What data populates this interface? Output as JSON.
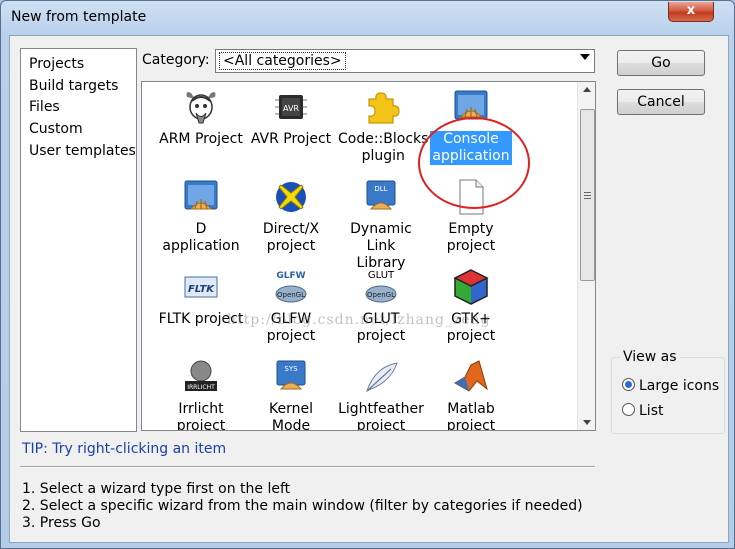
{
  "window": {
    "title": "New from template",
    "close_glyph": "x"
  },
  "left_list": {
    "items": [
      "Projects",
      "Build targets",
      "Files",
      "Custom",
      "User templates"
    ]
  },
  "category": {
    "label": "Category:",
    "value": "<All categories>"
  },
  "templates": [
    {
      "label": "ARM Project",
      "icon": "gnu-icon"
    },
    {
      "label": "AVR Project",
      "icon": "avr-chip-icon"
    },
    {
      "label": "Code::Blocks\nplugin",
      "icon": "puzzle-piece-icon"
    },
    {
      "label": "Console\napplication",
      "icon": "console-app-icon",
      "selected": true
    },
    {
      "label": "D application",
      "icon": "d-app-icon"
    },
    {
      "label": "Direct/X\nproject",
      "icon": "directx-icon"
    },
    {
      "label": "Dynamic Link\nLibrary",
      "icon": "dll-icon"
    },
    {
      "label": "Empty\nproject",
      "icon": "blank-document-icon"
    },
    {
      "label": "FLTK project",
      "icon": "fltk-icon"
    },
    {
      "label": "GLFW\nproject",
      "icon": "glfw-icon"
    },
    {
      "label": "GLUT\nproject",
      "icon": "glut-icon"
    },
    {
      "label": "GTK+\nproject",
      "icon": "gtk-icon"
    },
    {
      "label": "Irrlicht\nproject",
      "icon": "irrlicht-icon"
    },
    {
      "label": "Kernel Mode\nDriver",
      "icon": "sys-driver-icon"
    },
    {
      "label": "Lightfeather\nproject",
      "icon": "feather-icon"
    },
    {
      "label": "Matlab\nproject",
      "icon": "matlab-icon"
    }
  ],
  "icon_text": {
    "avr": "AVR",
    "dll": "DLL",
    "fltk": "FLTK",
    "glfw": "GLFW",
    "glut": "GLUT",
    "sys": "SYS",
    "irrlicht": "IRRLICHT",
    "opengl": "OpenGL"
  },
  "watermark": "http://blog.csdn.net/lzhang_zeng",
  "buttons": {
    "go": "Go",
    "cancel": "Cancel"
  },
  "view_as": {
    "title": "View as",
    "large_icons": "Large icons",
    "list": "List",
    "selected": "Large icons"
  },
  "tip": "TIP: Try right-clicking an item",
  "instructions": [
    "1. Select a wizard type first on the left",
    "2. Select a specific wizard from the main window (filter by categories if needed)",
    "3. Press Go"
  ],
  "colors": {
    "selection": "#3399ff",
    "tip_text": "#1a3fa8",
    "highlight_circle": "#e02020"
  }
}
